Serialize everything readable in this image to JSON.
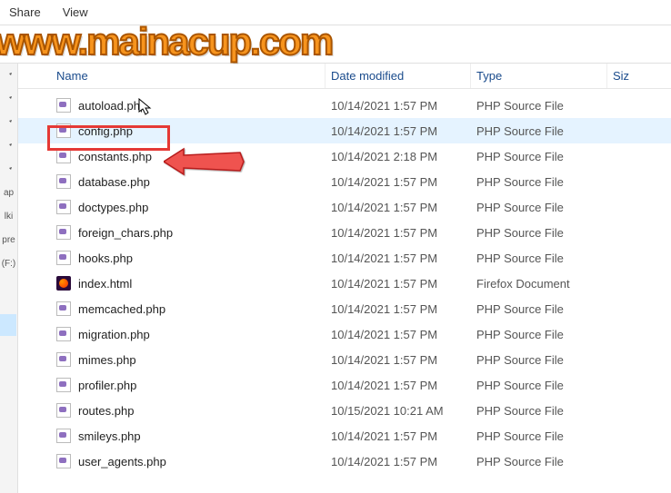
{
  "menu": {
    "share": "Share",
    "view": "View"
  },
  "watermark": "www.mainacup.com",
  "leftbar": {
    "items": [
      "ap",
      "lki",
      "pre",
      "(F:)"
    ]
  },
  "columns": {
    "name": "Name",
    "date": "Date modified",
    "type": "Type",
    "size": "Siz"
  },
  "files": [
    {
      "name": "autoload.php",
      "date": "10/14/2021 1:57 PM",
      "type": "PHP Source File",
      "icon": "php",
      "selected": false
    },
    {
      "name": "config.php",
      "date": "10/14/2021 1:57 PM",
      "type": "PHP Source File",
      "icon": "php",
      "selected": true
    },
    {
      "name": "constants.php",
      "date": "10/14/2021 2:18 PM",
      "type": "PHP Source File",
      "icon": "php",
      "selected": false
    },
    {
      "name": "database.php",
      "date": "10/14/2021 1:57 PM",
      "type": "PHP Source File",
      "icon": "php",
      "selected": false
    },
    {
      "name": "doctypes.php",
      "date": "10/14/2021 1:57 PM",
      "type": "PHP Source File",
      "icon": "php",
      "selected": false
    },
    {
      "name": "foreign_chars.php",
      "date": "10/14/2021 1:57 PM",
      "type": "PHP Source File",
      "icon": "php",
      "selected": false
    },
    {
      "name": "hooks.php",
      "date": "10/14/2021 1:57 PM",
      "type": "PHP Source File",
      "icon": "php",
      "selected": false
    },
    {
      "name": "index.html",
      "date": "10/14/2021 1:57 PM",
      "type": "Firefox Document",
      "icon": "firefox",
      "selected": false
    },
    {
      "name": "memcached.php",
      "date": "10/14/2021 1:57 PM",
      "type": "PHP Source File",
      "icon": "php",
      "selected": false
    },
    {
      "name": "migration.php",
      "date": "10/14/2021 1:57 PM",
      "type": "PHP Source File",
      "icon": "php",
      "selected": false
    },
    {
      "name": "mimes.php",
      "date": "10/14/2021 1:57 PM",
      "type": "PHP Source File",
      "icon": "php",
      "selected": false
    },
    {
      "name": "profiler.php",
      "date": "10/14/2021 1:57 PM",
      "type": "PHP Source File",
      "icon": "php",
      "selected": false
    },
    {
      "name": "routes.php",
      "date": "10/15/2021 10:21 AM",
      "type": "PHP Source File",
      "icon": "php",
      "selected": false
    },
    {
      "name": "smileys.php",
      "date": "10/14/2021 1:57 PM",
      "type": "PHP Source File",
      "icon": "php",
      "selected": false
    },
    {
      "name": "user_agents.php",
      "date": "10/14/2021 1:57 PM",
      "type": "PHP Source File",
      "icon": "php",
      "selected": false
    }
  ]
}
